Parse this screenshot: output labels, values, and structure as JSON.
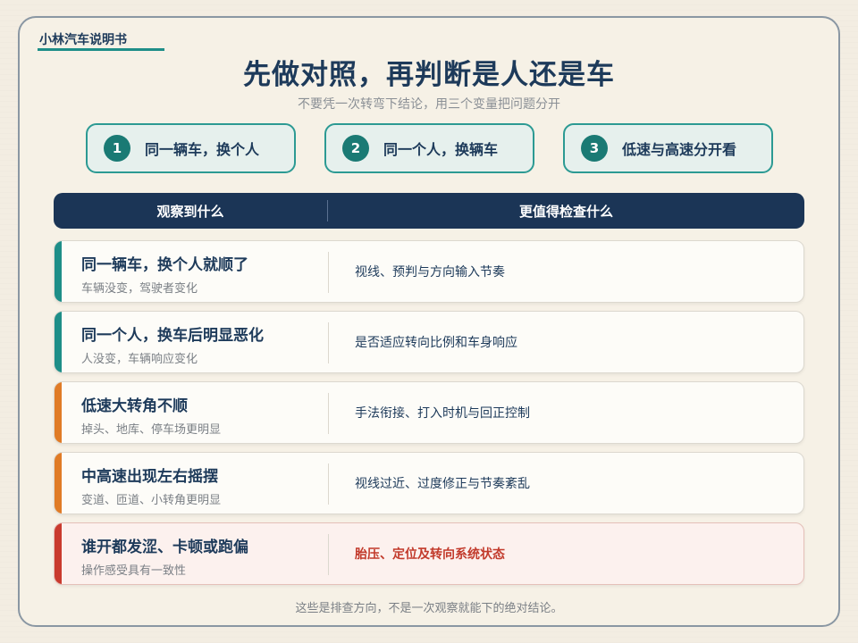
{
  "brand": "小林汽车说明书",
  "title": "先做对照，再判断是人还是车",
  "subtitle": "不要凭一次转弯下结论，用三个变量把问题分开",
  "steps": [
    {
      "num": "1",
      "label": "同一辆车，换个人"
    },
    {
      "num": "2",
      "label": "同一个人，换辆车"
    },
    {
      "num": "3",
      "label": "低速与高速分开看"
    }
  ],
  "table": {
    "headers": {
      "observe": "观察到什么",
      "check": "更值得检查什么"
    },
    "rows": [
      {
        "main": "同一辆车，换个人就顺了",
        "sub": "车辆没变，驾驶者变化",
        "check": "视线、预判与方向输入节奏",
        "accent": "#1e8e88"
      },
      {
        "main": "同一个人，换车后明显恶化",
        "sub": "人没变，车辆响应变化",
        "check": "是否适应转向比例和车身响应",
        "accent": "#1e8e88"
      },
      {
        "main": "低速大转角不顺",
        "sub": "掉头、地库、停车场更明显",
        "check": "手法衔接、打入时机与回正控制",
        "accent": "#e07b26"
      },
      {
        "main": "中高速出现左右摇摆",
        "sub": "变道、匝道、小转角更明显",
        "check": "视线过近、过度修正与节奏紊乱",
        "accent": "#e07b26"
      },
      {
        "main": "谁开都发涩、卡顿或跑偏",
        "sub": "操作感受具有一致性",
        "check": "胎压、定位及转向系统状态",
        "accent": "#c93a2e"
      }
    ]
  },
  "footer": "这些是排查方向，不是一次观察就能下的绝对结论。"
}
